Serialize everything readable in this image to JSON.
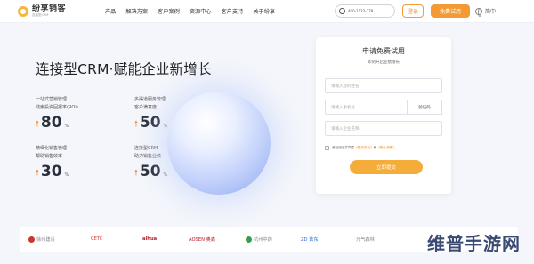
{
  "header": {
    "logo_name": "纷享销客",
    "logo_slogan": "连接型CRM",
    "nav": [
      "产品",
      "解决方案",
      "客户案例",
      "资源中心",
      "客户支持",
      "关于纷享"
    ],
    "phone_text": "400-1122-778",
    "login_label": "登录",
    "trial_label": "免费试用",
    "lang_label": "简中"
  },
  "hero": {
    "title": "连接型CRM·赋能企业新增长",
    "stats": [
      {
        "line1": "一站式营销管理",
        "line2": "线索投资回报率(ROI)",
        "value": "80",
        "unit": "%"
      },
      {
        "line1": "多渠道服务管理",
        "line2": "客户满意度",
        "value": "50",
        "unit": "%"
      },
      {
        "line1": "精细化销售管理",
        "line2": "帮助销售效率",
        "value": "30",
        "unit": "%"
      },
      {
        "line1": "连接型CRM",
        "line2": "助力销售业绩",
        "value": "50",
        "unit": "%"
      }
    ]
  },
  "form": {
    "title": "申请免费试用",
    "subtitle": "即刻开启业绩增长",
    "name_placeholder": "请输入您的姓名",
    "phone_placeholder": "请输入手机号",
    "code_button": "验证码",
    "company_placeholder": "请输入企业名称",
    "agree_prefix": "我已阅读并同意",
    "agree_link1": "《服务协议》",
    "agree_and": "和",
    "agree_link2": "《隐私政策》",
    "submit_label": "立即提交"
  },
  "partners": [
    {
      "name": "徐州建设",
      "color": "#c23a2a"
    },
    {
      "name": "CETC",
      "color": "#d8412f"
    },
    {
      "name": "alhua",
      "color": "#b8202a"
    },
    {
      "name": "AOSEN 奥森",
      "color": "#b8202a"
    },
    {
      "name": "杭州中药",
      "color": "#3c9a4a"
    },
    {
      "name": "ZD 紫东",
      "color": "#2b6bd8"
    },
    {
      "name": "元气森林",
      "color": "#8a8a8a"
    }
  ],
  "watermark": "维普手游网"
}
